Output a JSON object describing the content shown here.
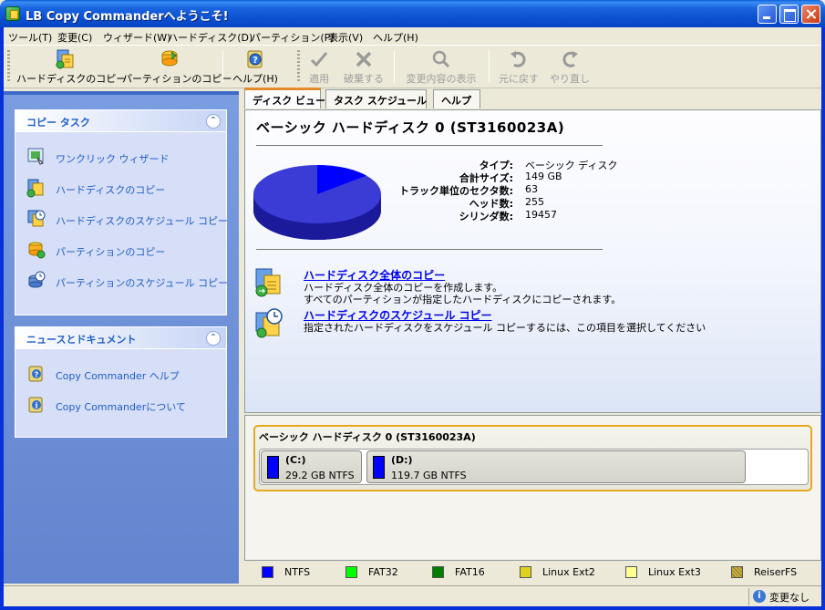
{
  "window": {
    "title": "LB Copy Commanderへようこそ!"
  },
  "menu": [
    "ツール(T)",
    "変更(C)",
    "ウィザード(W)",
    "ハードディスク(D)",
    "パーティション(P)",
    "表示(V)",
    "ヘルプ(H)"
  ],
  "toolbar": {
    "copy_disk": "ハードディスクのコピー",
    "copy_partition": "パーティションのコピー",
    "help": "ヘルプ(H)",
    "apply": "適用",
    "discard": "破棄する",
    "view_changes": "変更内容の表示",
    "undo": "元に戻す",
    "redo": "やり直し"
  },
  "copy_tasks": {
    "title": "コピー タスク",
    "items": [
      "ワンクリック ウィザード",
      "ハードディスクのコピー",
      "ハードディスクのスケジュール コピー",
      "パーティションのコピー",
      "パーティションのスケジュール コピー"
    ]
  },
  "news": {
    "title": "ニュースとドキュメント",
    "items": [
      "Copy Commander ヘルプ",
      "Copy Commanderについて"
    ]
  },
  "tabs": [
    "ディスク ビュー",
    "タスク スケジュール",
    "ヘルプ"
  ],
  "disk": {
    "title": "ベーシック ハードディスク 0 (ST3160023A)",
    "props": [
      {
        "k": "タイプ:",
        "v": "ベーシック ディスク"
      },
      {
        "k": "合計サイズ:",
        "v": "149 GB"
      },
      {
        "k": "トラック単位のセクタ数:",
        "v": "63"
      },
      {
        "k": "ヘッド数:",
        "v": "255"
      },
      {
        "k": "シリンダ数:",
        "v": "19457"
      }
    ],
    "pie": {
      "used_fraction": 0.86,
      "colors": {
        "main": "#3b3bd6",
        "slice": "#0000ff",
        "side": "#1a1a9a"
      }
    }
  },
  "actions": [
    {
      "link": "ハードディスク全体のコピー",
      "desc1": "ハードディスク全体のコピーを作成します。",
      "desc2": "すべてのパーティションが指定したハードディスクにコピーされます。"
    },
    {
      "link": "ハードディスクのスケジュール コピー",
      "desc1": "指定されたハードディスクをスケジュール コピーするには、この項目を選択してください",
      "desc2": ""
    }
  ],
  "diskmap": {
    "title": "ベーシック ハードディスク 0 (ST3160023A)",
    "partitions": [
      {
        "label": "(C:)",
        "size": "29.2 GB NTFS"
      },
      {
        "label": "(D:)",
        "size": "119.7 GB NTFS"
      }
    ]
  },
  "legend": [
    {
      "name": "NTFS",
      "color": "#0000ff"
    },
    {
      "name": "FAT32",
      "color": "#00ff00"
    },
    {
      "name": "FAT16",
      "color": "#008000"
    },
    {
      "name": "Linux Ext2",
      "color": "#e0d020"
    },
    {
      "name": "Linux Ext3",
      "color": "#ffff90"
    },
    {
      "name": "ReiserFS",
      "color": "#c8b040"
    }
  ],
  "status": {
    "text": "変更なし"
  }
}
